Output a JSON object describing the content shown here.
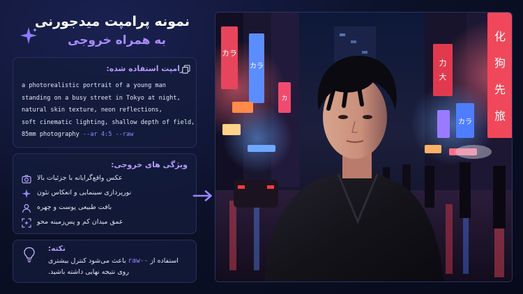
{
  "header": {
    "title_line1": "نمونه پرامپت میدجورنی",
    "title_line2": "به همراه خروجی",
    "icon": "sparkle-icon"
  },
  "prompt_card": {
    "heading": "پرامپت استفاده شده:",
    "copy_icon": "copy-icon",
    "lines": [
      "a photorealistic portrait of a young man",
      "standing on a busy street in Tokyo at night,",
      "natural skin texture, neon reflections,",
      "soft cinematic lighting, shallow depth of field,",
      "85mm photography"
    ],
    "params": "--ar 4:5 --raw"
  },
  "features_card": {
    "heading": "ویژگی های خروجی:",
    "items": [
      {
        "icon": "camera-icon",
        "label": "عکس واقع‌گرایانه با جزئیات بالا"
      },
      {
        "icon": "sparkle-icon",
        "label": "نورپردازی سینمایی و انعکاس نئون"
      },
      {
        "icon": "person-icon",
        "label": "بافت طبیعی پوست و چهره"
      },
      {
        "icon": "focus-icon",
        "label": "عمق میدان کم و پس‌زمینه محو"
      }
    ]
  },
  "note_card": {
    "icon": "lightbulb-icon",
    "title": "نکته:",
    "line1_prefix": "استفاده از",
    "line1_code": "--raw",
    "line1_suffix": "باعث می‌شود کنترل بیشتری",
    "line2": "روی نتیجه نهایی داشته باشید."
  },
  "photo": {
    "subject": "young man on neon-lit Tokyo street at night",
    "signs": [
      "カラ",
      "カラ",
      "カ",
      "力",
      "大",
      "カラ",
      "カ",
      "力木",
      "化",
      "狗",
      "先",
      "旅"
    ]
  },
  "colors": {
    "background": "#0b1026",
    "accent": "#a98bff",
    "card": "#141c3c",
    "text": "#e6e8f5"
  }
}
